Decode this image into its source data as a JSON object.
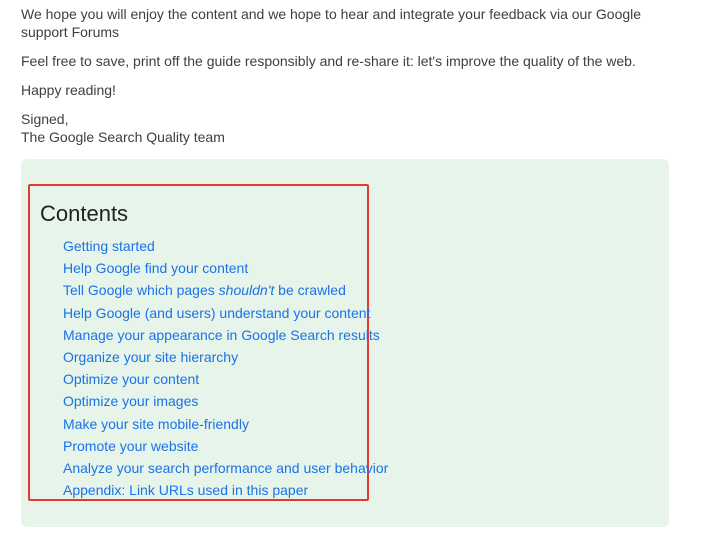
{
  "intro": {
    "paragraph1": "We hope you will enjoy the content and we hope to hear and integrate your feedback via our Google support Forums",
    "paragraph2": "Feel free to save, print off the guide responsibly and re-share it: let's improve the quality of the web.",
    "paragraph3": "Happy reading!",
    "signed": "Signed,",
    "team": "The Google Search Quality team"
  },
  "contents": {
    "title": "Contents",
    "items": [
      {
        "label": "Getting started"
      },
      {
        "label": "Help Google find your content"
      },
      {
        "label_before": "Tell Google which pages ",
        "label_em": "shouldn't",
        "label_after": " be crawled"
      },
      {
        "label": "Help Google (and users) understand your content"
      },
      {
        "label": "Manage your appearance in Google Search results"
      },
      {
        "label": "Organize your site hierarchy"
      },
      {
        "label": "Optimize your content"
      },
      {
        "label": "Optimize your images"
      },
      {
        "label": "Make your site mobile-friendly"
      },
      {
        "label": "Promote your website"
      },
      {
        "label": "Analyze your search performance and user behavior"
      },
      {
        "label": "Appendix: Link URLs used in this paper"
      }
    ]
  },
  "colors": {
    "panel_background": "#e6f4ea",
    "link": "#1a73e8",
    "highlight_border": "#e53935"
  }
}
